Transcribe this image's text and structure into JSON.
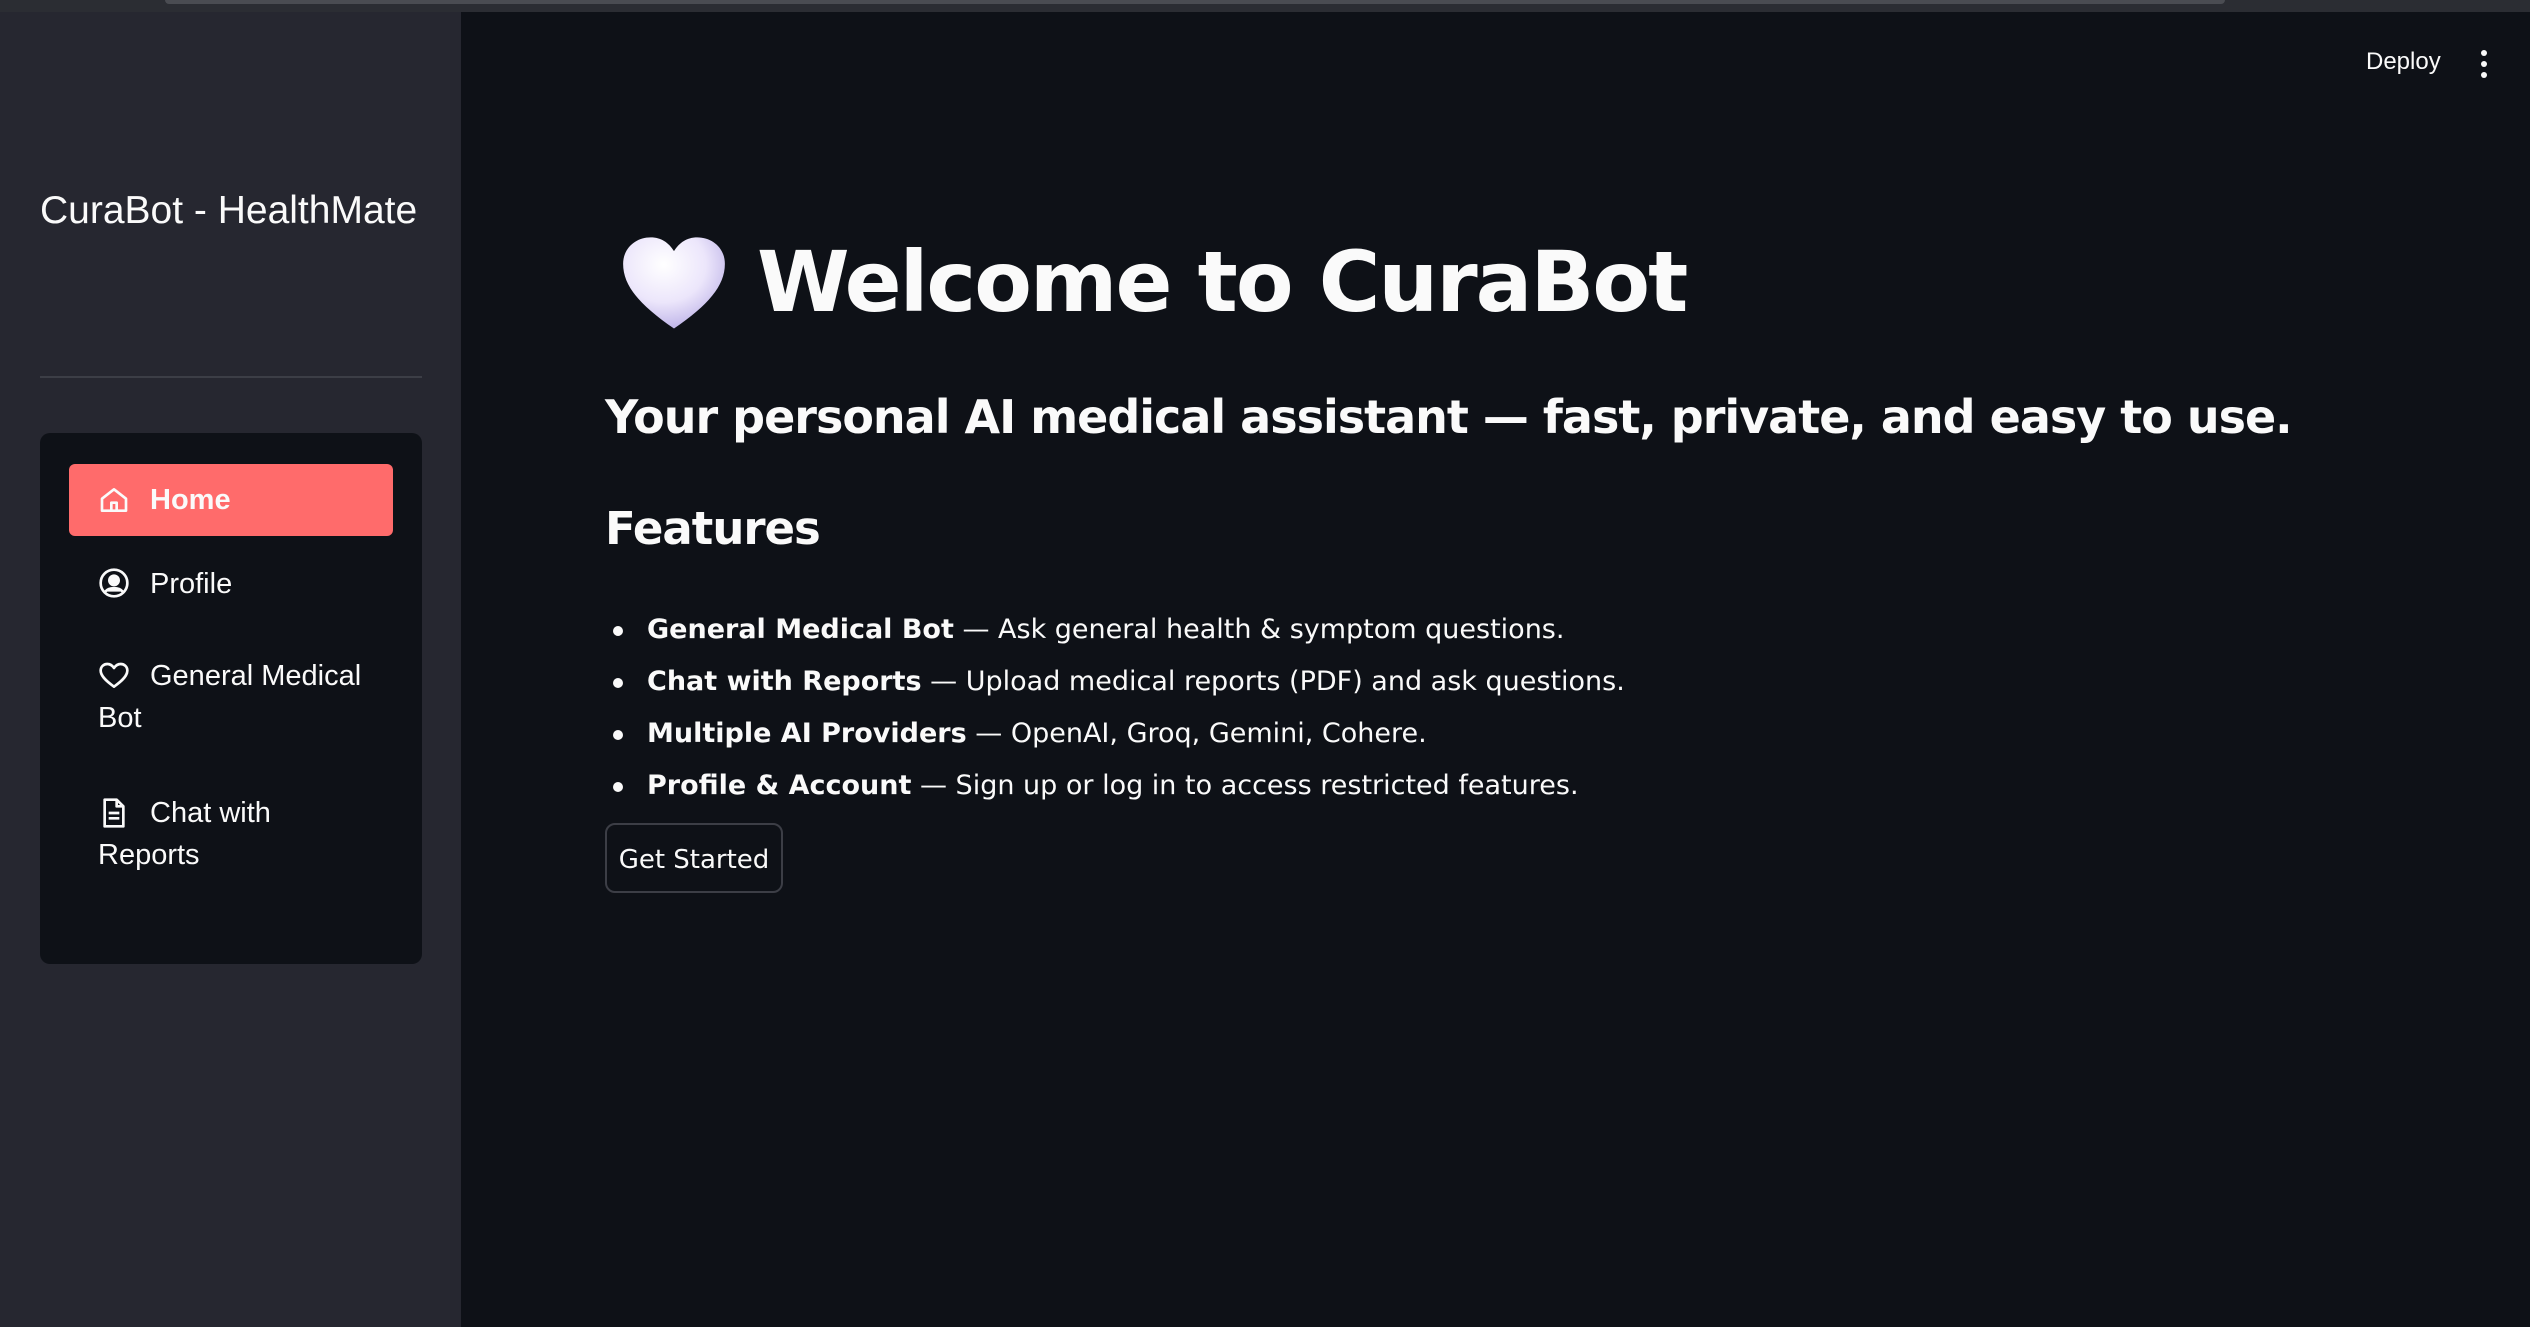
{
  "header": {
    "deploy_label": "Deploy"
  },
  "sidebar": {
    "brand": "CuraBot - HealthMate",
    "nav": [
      {
        "label": "Home",
        "icon": "home-icon",
        "active": true
      },
      {
        "label": "Profile",
        "icon": "user-circle-icon",
        "active": false
      },
      {
        "label_line1": "General Medical",
        "label_line2": "Bot",
        "icon": "heart-outline-icon",
        "active": false
      },
      {
        "label_line1": "Chat with",
        "label_line2": "Reports",
        "icon": "document-icon",
        "active": false
      }
    ]
  },
  "main": {
    "title": "Welcome to CuraBot",
    "subtitle": "Your personal AI medical assistant — fast, private, and easy to use.",
    "features_heading": "Features",
    "features": [
      {
        "name": "General Medical Bot",
        "desc": " — Ask general health & symptom questions."
      },
      {
        "name": "Chat with Reports",
        "desc": " — Upload medical reports (PDF) and ask questions."
      },
      {
        "name": "Multiple AI Providers",
        "desc": " — OpenAI, Groq, Gemini, Cohere."
      },
      {
        "name": "Profile & Account",
        "desc": " — Sign up or log in to access restricted features."
      }
    ],
    "cta_label": "Get Started"
  },
  "colors": {
    "accent": "#ff6b6b",
    "background": "#0e1117",
    "sidebar": "#262730"
  }
}
